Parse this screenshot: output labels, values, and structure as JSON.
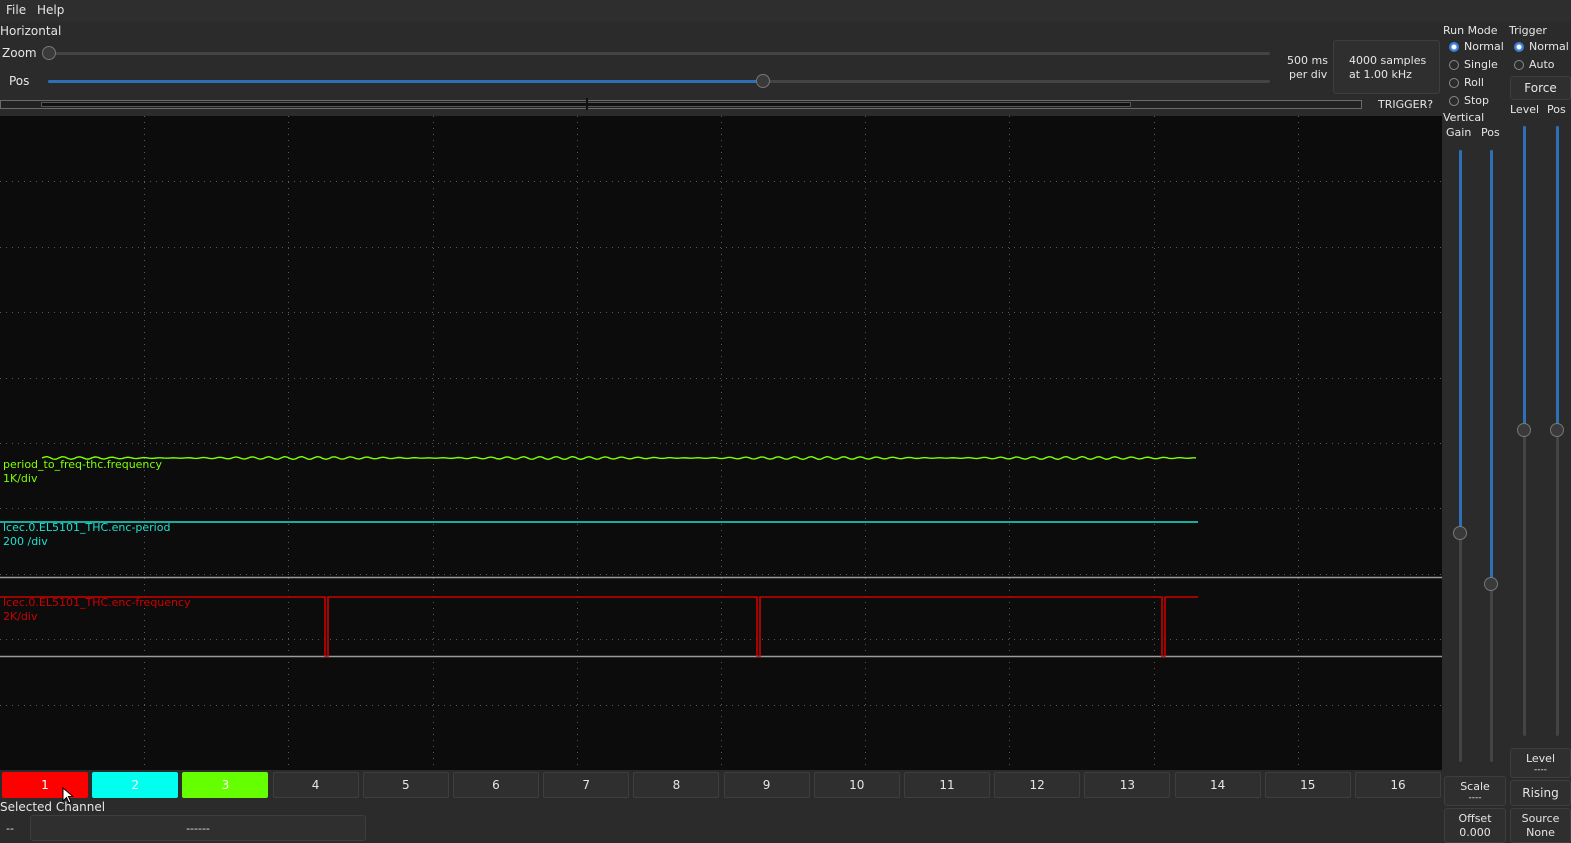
{
  "menu": {
    "file": "File",
    "help": "Help"
  },
  "horizontal": {
    "section_label": "Horizontal",
    "zoom_label": "Zoom",
    "pos_label": "Pos",
    "timebase": "500 ms",
    "timebase_unit": "per div",
    "samples": "4000 samples",
    "rate": "at 1.00 kHz",
    "trigger_status": "TRIGGER?",
    "zoom_value": 0,
    "pos_value": 0.59
  },
  "run_mode": {
    "label": "Run Mode",
    "options": [
      "Normal",
      "Single",
      "Roll",
      "Stop"
    ],
    "selected": "Normal"
  },
  "trigger": {
    "label": "Trigger",
    "options": [
      "Normal",
      "Auto"
    ],
    "selected": "Normal",
    "force_label": "Force",
    "level_label": "Level",
    "pos_label": "Pos",
    "level_readout_label": "Level",
    "level_readout_value": "----",
    "edge_button": "Rising",
    "source_label": "Source",
    "source_value": "None"
  },
  "vertical": {
    "label": "Vertical",
    "gain_label": "Gain",
    "pos_label": "Pos",
    "scale_label": "Scale",
    "scale_value": "----",
    "offset_label": "Offset",
    "offset_value": "0.000"
  },
  "traces": [
    {
      "name": "period_to_freq-thc.frequency",
      "scale": "1K/div",
      "color": "#7fff00"
    },
    {
      "name": "lcec.0.EL5101_THC.enc-period",
      "scale": "200 /div",
      "color": "#1de0d0"
    },
    {
      "name": "lcec.0.EL5101_THC.enc-frequency",
      "scale": "2K/div",
      "color": "#cc0000"
    }
  ],
  "channels": {
    "buttons": [
      "1",
      "2",
      "3",
      "4",
      "5",
      "6",
      "7",
      "8",
      "9",
      "10",
      "11",
      "12",
      "13",
      "14",
      "15",
      "16"
    ],
    "colors": {
      "1": "#ff0000",
      "2": "#00ffee",
      "3": "#66ff00"
    }
  },
  "selected_channel": {
    "label": "Selected Channel",
    "id": "--",
    "name": "------"
  }
}
